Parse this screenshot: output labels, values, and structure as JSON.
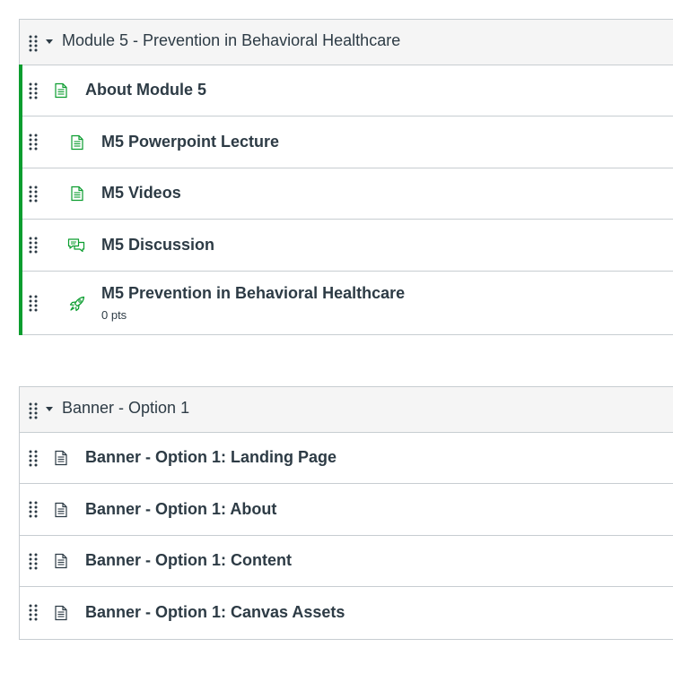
{
  "modules": [
    {
      "title": "Module 5 - Prevention in Behavioral Healthcare",
      "items": [
        {
          "title": "About Module 5",
          "icon": "page-icon"
        },
        {
          "title": "M5 Powerpoint Lecture",
          "icon": "page-icon"
        },
        {
          "title": "M5 Videos",
          "icon": "page-icon"
        },
        {
          "title": "M5 Discussion",
          "icon": "discussion-icon"
        },
        {
          "title": "M5 Prevention in Behavioral Healthcare",
          "subtitle": "0 pts",
          "icon": "assignment-icon"
        }
      ]
    },
    {
      "title": "Banner - Option 1",
      "items": [
        {
          "title": "Banner - Option 1: Landing Page",
          "icon": "page-icon"
        },
        {
          "title": "Banner - Option 1: About",
          "icon": "page-icon"
        },
        {
          "title": "Banner - Option 1: Content",
          "icon": "page-icon"
        },
        {
          "title": "Banner - Option 1: Canvas Assets",
          "icon": "page-icon"
        }
      ]
    }
  ],
  "colors": {
    "published": "#0b9d2f",
    "text": "#2d3b45",
    "border": "#c7cdd1",
    "header_bg": "#f5f5f5",
    "unpublished_icon": "#2d3b45"
  }
}
